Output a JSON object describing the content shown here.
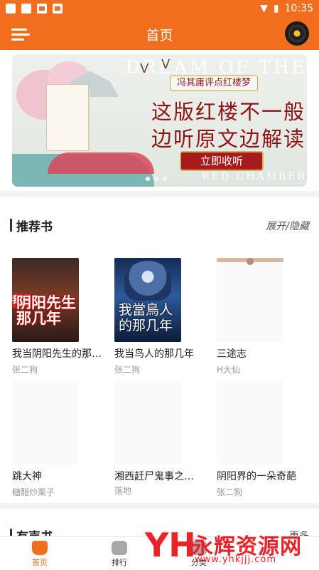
{
  "status_bar": {
    "time": "10:35"
  },
  "app_bar": {
    "title": "首页"
  },
  "banner": {
    "ghost_text_top": "DREAM OF THE",
    "ghost_text_bottom": "RED CHAMBER",
    "subtitle": "冯其庸评点红楼梦",
    "line1": "这版红楼不一般",
    "line2": "边听原文边解读",
    "cta": "立即收听",
    "slides": 3,
    "active_slide": 1
  },
  "recommended": {
    "title": "推荐书",
    "toggle": "展开/隐藏",
    "books": [
      {
        "name": "我当阴阳先生的那几年",
        "author": "张二狗",
        "cover_text": "我当\n阴阳先生\n那几年"
      },
      {
        "name": "我当鸟人的那几年",
        "author": "张二狗",
        "cover_text": "我當鳥人\n的那几年"
      },
      {
        "name": "三途志",
        "author": "H大仙",
        "cover_text": ""
      },
      {
        "name": "跳大神",
        "author": "糖醋炒栗子",
        "cover_text": ""
      },
      {
        "name": "湘西赶尸鬼事之…",
        "author": "落地",
        "cover_text": ""
      },
      {
        "name": "阴阳界的一朵奇葩",
        "author": "张二狗",
        "cover_text": ""
      }
    ]
  },
  "next_section": {
    "title": "有声书",
    "more": "更多"
  },
  "tab_bar": {
    "tabs": [
      {
        "label": "首页",
        "active": true
      },
      {
        "label": "排行",
        "active": false
      },
      {
        "label": "分类",
        "active": false
      }
    ]
  },
  "watermark": {
    "logo": "YH",
    "name": "永辉资源网",
    "url": "www.yhkjjj.com"
  },
  "colors": {
    "brand": "#f06e1e",
    "banner_red": "#8b1515",
    "watermark_red": "#e8242a"
  }
}
